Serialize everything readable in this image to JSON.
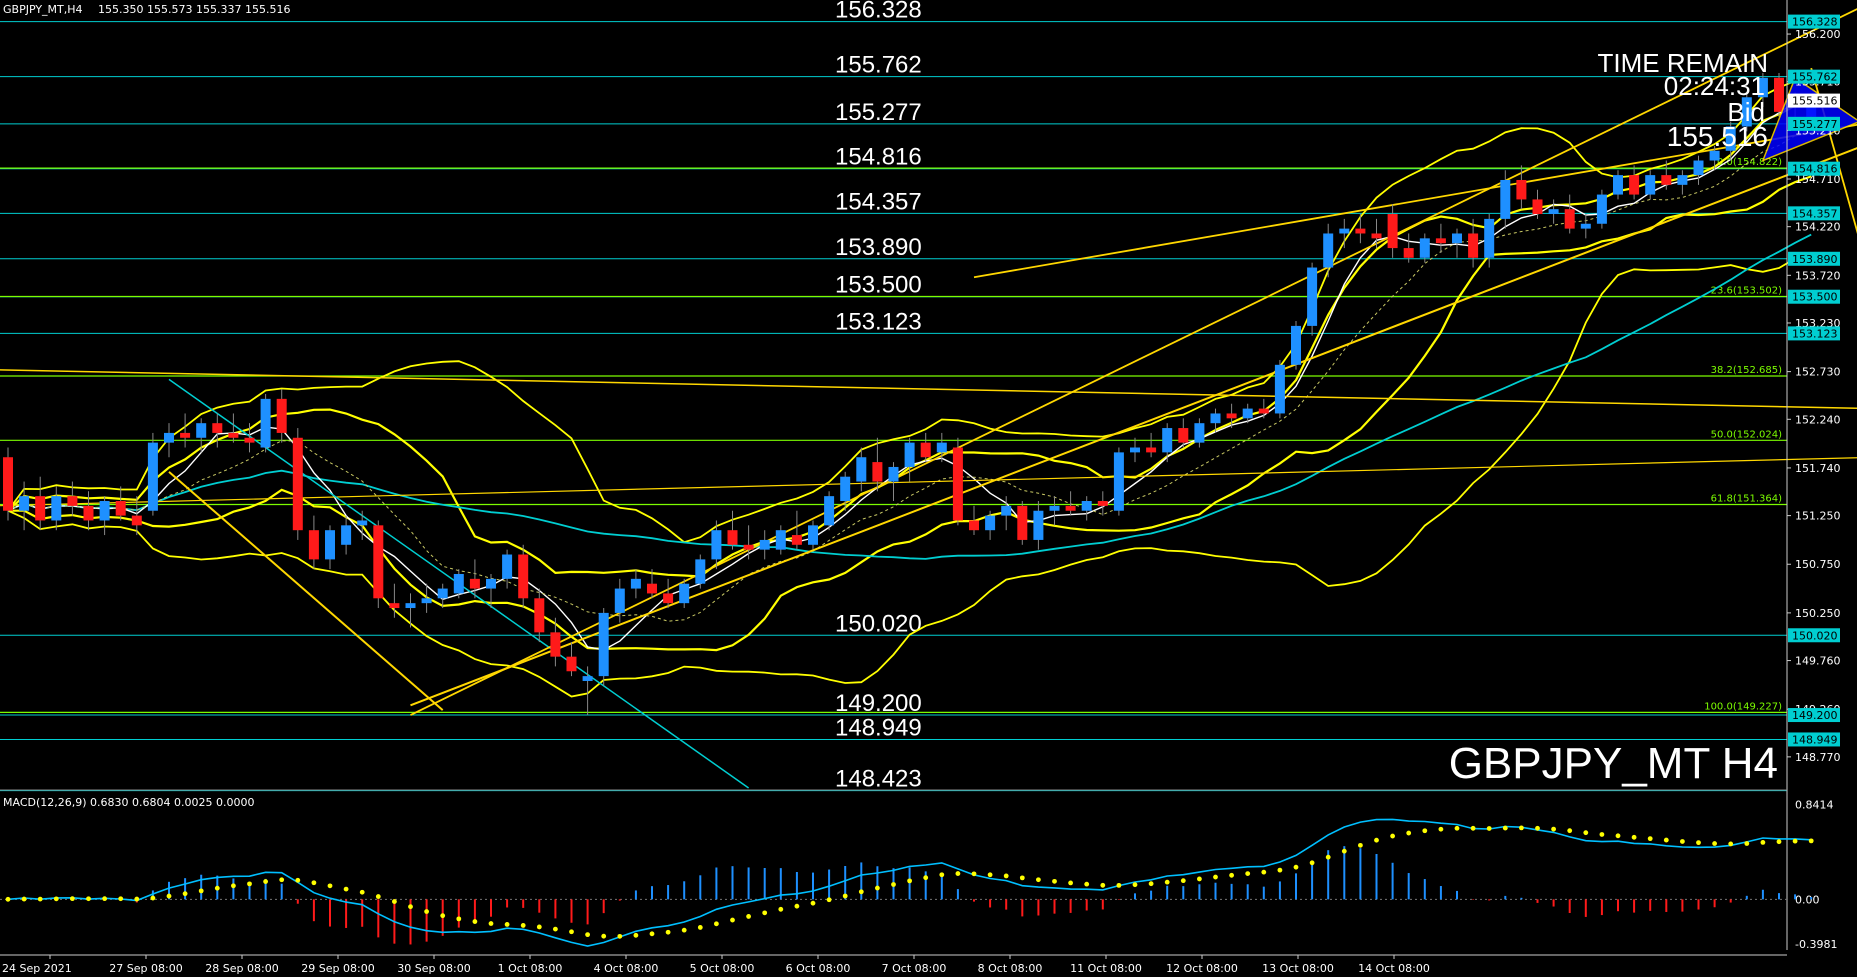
{
  "header": {
    "symbol_info": "GBPJPY_MT,H4",
    "ohlc": "155.350 155.573 155.337 155.516"
  },
  "watermark": "GBPJPY_MT H4",
  "time_remain": {
    "label": "TIME REMAIN",
    "value": "02:24:31",
    "bid_label": "Bid",
    "bid_value": "155.516"
  },
  "macd_label": "MACD(12,26,9) 0.6830 0.6804 0.0025 0.0000",
  "colors": {
    "background": "#000000",
    "bull": "#1e90ff",
    "bear": "#ff1a1a",
    "level_line": "#00ced1",
    "fib_line": "#7cfc00",
    "bands": "#ffff00",
    "trend": "#ffd700",
    "macd_line": "#00bfff",
    "signal_dots": "#ffff00"
  },
  "chart_data": {
    "type": "candlestick",
    "price_axis": {
      "ticks": [
        "156.200",
        "155.710",
        "155.210",
        "154.710",
        "154.220",
        "153.720",
        "153.230",
        "152.730",
        "152.240",
        "151.740",
        "151.250",
        "150.750",
        "150.250",
        "149.760",
        "149.260",
        "148.770"
      ],
      "ylim": [
        148.45,
        156.55
      ]
    },
    "time_axis": [
      "24 Sep 2021",
      "27 Sep 08:00",
      "28 Sep 08:00",
      "29 Sep 08:00",
      "30 Sep 08:00",
      "1 Oct 08:00",
      "4 Oct 08:00",
      "5 Oct 08:00",
      "6 Oct 08:00",
      "7 Oct 08:00",
      "8 Oct 08:00",
      "11 Oct 08:00",
      "12 Oct 08:00",
      "13 Oct 08:00",
      "14 Oct 08:00"
    ],
    "horizontal_levels": [
      {
        "label": "156.328",
        "value": 156.328,
        "tag": "156.328"
      },
      {
        "label": "155.762",
        "value": 155.762,
        "tag": "155.762"
      },
      {
        "label": "155.277",
        "value": 155.277,
        "tag": "155.277"
      },
      {
        "label": "154.816",
        "value": 154.816,
        "tag": "154.816"
      },
      {
        "label": "154.357",
        "value": 154.357,
        "tag": "154.357"
      },
      {
        "label": "153.890",
        "value": 153.89,
        "tag": "153.890"
      },
      {
        "label": "153.500",
        "value": 153.5,
        "tag": "153.500"
      },
      {
        "label": "153.123",
        "value": 153.123,
        "tag": "153.123"
      },
      {
        "label": "150.020",
        "value": 150.02,
        "tag": "150.020"
      },
      {
        "label": "149.200",
        "value": 149.2,
        "tag": "149.200"
      },
      {
        "label": "148.949",
        "value": 148.949,
        "tag": "148.949"
      },
      {
        "label": "148.423",
        "value": 148.423,
        "tag": ""
      }
    ],
    "fibonacci": [
      {
        "label": "0.0(154.822)",
        "value": 154.822
      },
      {
        "label": "23.6(153.502)",
        "value": 153.502
      },
      {
        "label": "38.2(152.685)",
        "value": 152.685
      },
      {
        "label": "50.0(152.024)",
        "value": 152.024
      },
      {
        "label": "61.8(151.364)",
        "value": 151.364
      },
      {
        "label": "100.0(149.227)",
        "value": 149.227
      }
    ],
    "candles": [
      [
        151.85,
        151.95,
        151.2,
        151.3
      ],
      [
        151.3,
        151.6,
        151.1,
        151.45
      ],
      [
        151.45,
        151.65,
        151.1,
        151.2
      ],
      [
        151.2,
        151.55,
        151.1,
        151.45
      ],
      [
        151.45,
        151.6,
        151.25,
        151.35
      ],
      [
        151.35,
        151.5,
        151.1,
        151.2
      ],
      [
        151.2,
        151.45,
        151.05,
        151.4
      ],
      [
        151.4,
        151.55,
        151.2,
        151.25
      ],
      [
        151.25,
        151.45,
        151.05,
        151.15
      ],
      [
        151.3,
        152.1,
        151.25,
        152.0
      ],
      [
        152.0,
        152.2,
        151.85,
        152.1
      ],
      [
        152.1,
        152.3,
        151.95,
        152.05
      ],
      [
        152.05,
        152.25,
        151.9,
        152.2
      ],
      [
        152.2,
        152.3,
        151.95,
        152.1
      ],
      [
        152.1,
        152.3,
        152.0,
        152.05
      ],
      [
        152.05,
        152.2,
        151.9,
        152.0
      ],
      [
        151.95,
        152.5,
        151.9,
        152.45
      ],
      [
        152.45,
        152.55,
        152.0,
        152.1
      ],
      [
        152.05,
        152.15,
        151.0,
        151.1
      ],
      [
        151.1,
        151.25,
        150.7,
        150.8
      ],
      [
        150.8,
        151.15,
        150.7,
        151.1
      ],
      [
        150.95,
        151.25,
        150.85,
        151.15
      ],
      [
        151.15,
        151.3,
        151.0,
        151.2
      ],
      [
        151.15,
        151.2,
        150.3,
        150.4
      ],
      [
        150.35,
        150.55,
        150.2,
        150.3
      ],
      [
        150.3,
        150.45,
        150.1,
        150.35
      ],
      [
        150.35,
        150.55,
        150.25,
        150.4
      ],
      [
        150.4,
        150.55,
        150.3,
        150.5
      ],
      [
        150.45,
        150.7,
        150.4,
        150.65
      ],
      [
        150.6,
        150.8,
        150.4,
        150.5
      ],
      [
        150.5,
        150.65,
        150.3,
        150.6
      ],
      [
        150.6,
        150.9,
        150.5,
        150.85
      ],
      [
        150.85,
        150.95,
        150.3,
        150.4
      ],
      [
        150.4,
        150.5,
        149.95,
        150.05
      ],
      [
        150.05,
        150.2,
        149.7,
        149.8
      ],
      [
        149.8,
        149.95,
        149.6,
        149.65
      ],
      [
        149.55,
        149.7,
        149.2,
        149.6
      ],
      [
        149.6,
        150.3,
        149.5,
        150.25
      ],
      [
        150.25,
        150.6,
        150.15,
        150.5
      ],
      [
        150.5,
        150.7,
        150.4,
        150.6
      ],
      [
        150.55,
        150.7,
        150.4,
        150.45
      ],
      [
        150.45,
        150.6,
        150.3,
        150.35
      ],
      [
        150.35,
        150.6,
        150.3,
        150.55
      ],
      [
        150.55,
        150.85,
        150.5,
        150.8
      ],
      [
        150.8,
        151.2,
        150.7,
        151.1
      ],
      [
        151.1,
        151.3,
        150.9,
        150.95
      ],
      [
        150.95,
        151.15,
        150.8,
        150.9
      ],
      [
        150.9,
        151.1,
        150.8,
        151.0
      ],
      [
        150.9,
        151.15,
        150.85,
        151.1
      ],
      [
        151.05,
        151.3,
        150.9,
        150.95
      ],
      [
        150.95,
        151.2,
        150.9,
        151.15
      ],
      [
        151.15,
        151.5,
        151.1,
        151.45
      ],
      [
        151.4,
        151.7,
        151.3,
        151.65
      ],
      [
        151.6,
        151.95,
        151.5,
        151.85
      ],
      [
        151.8,
        152.05,
        151.5,
        151.6
      ],
      [
        151.6,
        151.8,
        151.4,
        151.75
      ],
      [
        151.75,
        152.05,
        151.6,
        152.0
      ],
      [
        152.0,
        152.1,
        151.8,
        151.85
      ],
      [
        151.9,
        152.1,
        151.8,
        152.0
      ],
      [
        151.95,
        152.05,
        151.15,
        151.2
      ],
      [
        151.2,
        151.35,
        151.05,
        151.1
      ],
      [
        151.1,
        151.3,
        151.0,
        151.25
      ],
      [
        151.25,
        151.45,
        151.1,
        151.35
      ],
      [
        151.35,
        151.4,
        150.95,
        151.0
      ],
      [
        151.0,
        151.4,
        150.9,
        151.3
      ],
      [
        151.3,
        151.45,
        151.15,
        151.35
      ],
      [
        151.35,
        151.5,
        151.25,
        151.3
      ],
      [
        151.3,
        151.45,
        151.2,
        151.4
      ],
      [
        151.4,
        151.5,
        151.25,
        151.35
      ],
      [
        151.3,
        151.95,
        151.25,
        151.9
      ],
      [
        151.9,
        152.05,
        151.8,
        151.95
      ],
      [
        151.95,
        152.1,
        151.85,
        151.9
      ],
      [
        151.9,
        152.2,
        151.8,
        152.15
      ],
      [
        152.15,
        152.25,
        151.95,
        152.0
      ],
      [
        152.0,
        152.25,
        151.95,
        152.2
      ],
      [
        152.2,
        152.35,
        152.1,
        152.3
      ],
      [
        152.3,
        152.4,
        152.15,
        152.25
      ],
      [
        152.25,
        152.4,
        152.2,
        152.35
      ],
      [
        152.35,
        152.45,
        152.25,
        152.3
      ],
      [
        152.3,
        152.85,
        152.25,
        152.8
      ],
      [
        152.8,
        153.25,
        152.75,
        153.2
      ],
      [
        153.2,
        153.85,
        153.1,
        153.8
      ],
      [
        153.8,
        154.25,
        153.7,
        154.15
      ],
      [
        154.15,
        154.3,
        154.0,
        154.2
      ],
      [
        154.2,
        154.35,
        154.05,
        154.15
      ],
      [
        154.15,
        154.3,
        154.0,
        154.1
      ],
      [
        154.35,
        154.45,
        153.9,
        154.0
      ],
      [
        154.0,
        154.15,
        153.85,
        153.9
      ],
      [
        153.9,
        154.15,
        153.85,
        154.1
      ],
      [
        154.1,
        154.25,
        153.95,
        154.05
      ],
      [
        154.05,
        154.2,
        153.9,
        154.15
      ],
      [
        154.15,
        154.3,
        153.8,
        153.9
      ],
      [
        153.9,
        154.35,
        153.8,
        154.3
      ],
      [
        154.3,
        154.8,
        154.2,
        154.7
      ],
      [
        154.7,
        154.85,
        154.4,
        154.5
      ],
      [
        154.5,
        154.6,
        154.3,
        154.35
      ],
      [
        154.35,
        154.5,
        154.25,
        154.4
      ],
      [
        154.4,
        154.55,
        154.15,
        154.2
      ],
      [
        154.2,
        154.35,
        154.1,
        154.25
      ],
      [
        154.25,
        154.6,
        154.2,
        154.55
      ],
      [
        154.55,
        154.8,
        154.5,
        154.75
      ],
      [
        154.75,
        154.85,
        154.5,
        154.55
      ],
      [
        154.55,
        154.8,
        154.5,
        154.75
      ],
      [
        154.75,
        154.9,
        154.6,
        154.65
      ],
      [
        154.65,
        154.8,
        154.55,
        154.75
      ],
      [
        154.75,
        154.95,
        154.65,
        154.9
      ],
      [
        154.9,
        155.05,
        154.8,
        155.0
      ],
      [
        155.0,
        155.3,
        154.9,
        155.25
      ],
      [
        155.25,
        155.6,
        155.2,
        155.55
      ],
      [
        155.55,
        155.8,
        155.45,
        155.75
      ],
      [
        155.75,
        155.8,
        155.35,
        155.4
      ],
      [
        155.45,
        155.6,
        155.35,
        155.55
      ],
      [
        155.35,
        155.57,
        155.34,
        155.52
      ]
    ],
    "macd": {
      "ylim": [
        -0.45,
        0.9
      ],
      "ticks": [
        "0.8414",
        "0.00",
        "-0.3981"
      ],
      "values": {
        "main": 0.683,
        "signal": 0.6804,
        "histogram": 0.0025
      }
    }
  }
}
